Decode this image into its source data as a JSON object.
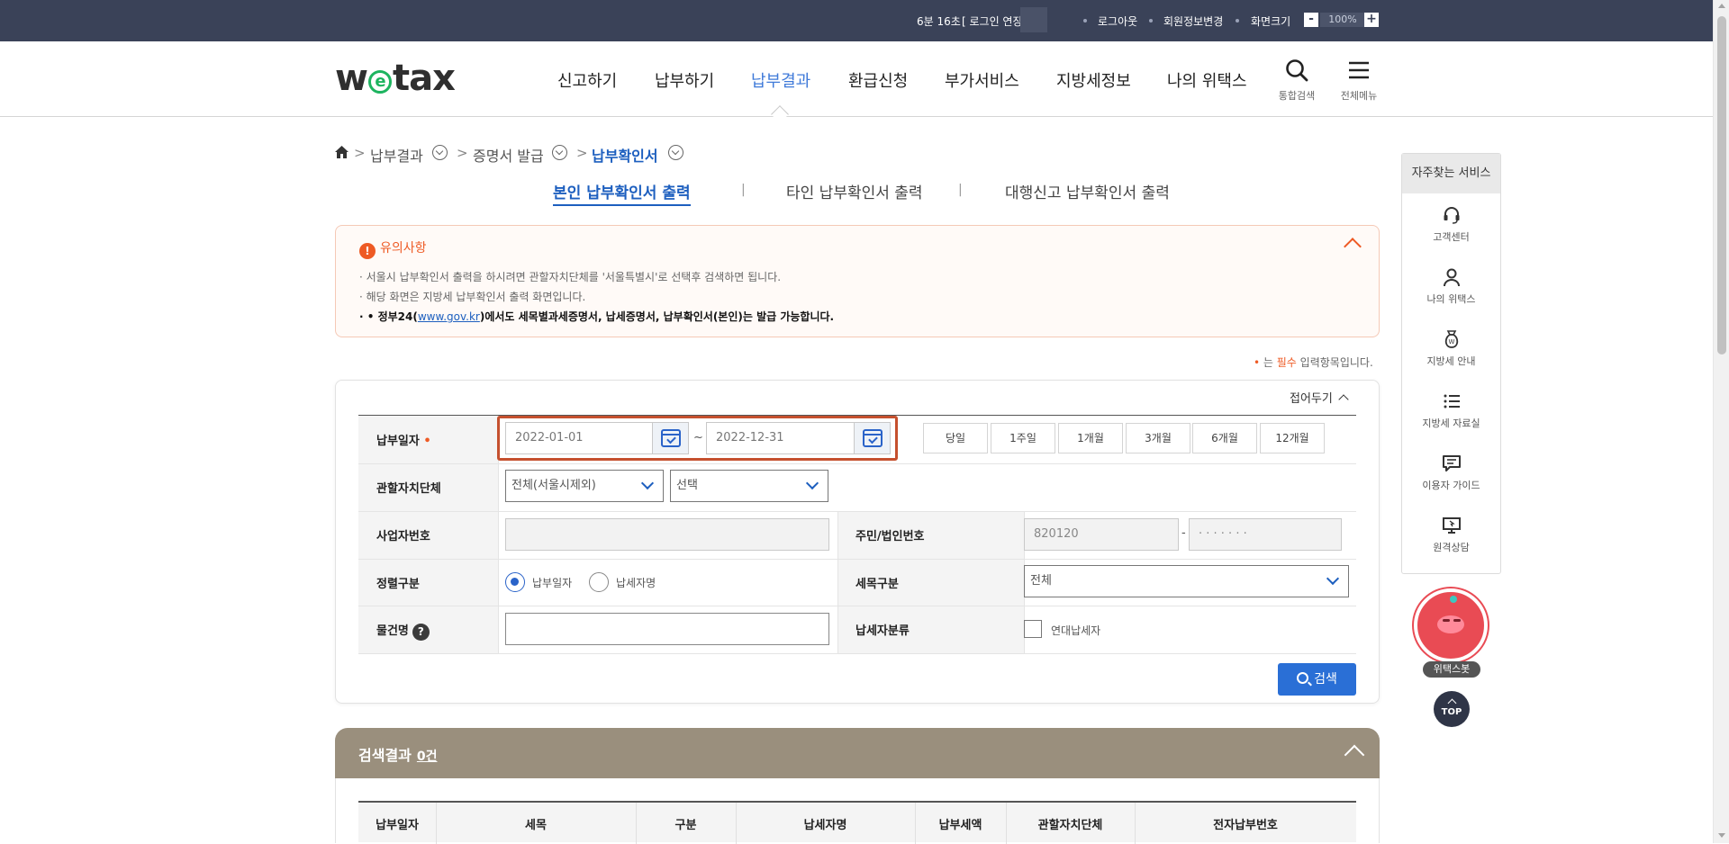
{
  "topbar": {
    "timer_text": "6분 16초",
    "login_extend": "[ 로그인 연장",
    "logout": "로그아웃",
    "profile_edit": "회원정보변경",
    "screen_size_label": "화면크기",
    "zoom_minus": "-",
    "zoom_value": "100%",
    "zoom_plus": "+"
  },
  "header": {
    "logo_pre": "w",
    "logo_e": "e",
    "logo_post": "tax",
    "nav": [
      "신고하기",
      "납부하기",
      "납부결과",
      "환급신청",
      "부가서비스",
      "지방세정보",
      "나의 위택스"
    ],
    "active_nav_index": 2,
    "search_label": "통합검색",
    "menu_label": "전체메뉴"
  },
  "breadcrumb": [
    "납부결과",
    "증명서 발급",
    "납부확인서"
  ],
  "tabs": [
    "본인 납부확인서 출력",
    "타인 납부확인서 출력",
    "대행신고 납부확인서 출력"
  ],
  "notice": {
    "title": "유의사항",
    "lines": [
      "· 서울시 납부확인서 출력을 하시려면 관할자치단체를 '서울특별시'로 선택후 검색하면 됩니다.",
      "· 해당 화면은 지방세 납부확인서 출력 화면입니다."
    ],
    "bold_pre": "· • 정부24(",
    "bold_link": "www.gov.kr",
    "bold_post": ")에서도 세목별과세증명서, 납세증명서, 납부확인서(본인)는 발급 가능합니다."
  },
  "required_note": {
    "mark": "•",
    "pre": " 는 ",
    "word": "필수",
    "post": " 입력항목입니다."
  },
  "form": {
    "fold_label": "접어두기",
    "pay_date_label": "납부일자",
    "req_mark": "•",
    "date_from": "2022-01-01",
    "date_tilde": "~",
    "date_to": "2022-12-31",
    "quick_ranges": [
      "당일",
      "1주일",
      "1개월",
      "3개월",
      "6개월",
      "12개월"
    ],
    "jurisdiction_label": "관할자치단체",
    "jurisdiction_sel1": "전체(서울시제외)",
    "jurisdiction_sel2": "선택",
    "biz_no_label": "사업자번호",
    "biz_no_value": "",
    "resident_label": "주민/법인번호",
    "resident_front": "820120",
    "resident_dash": "-",
    "resident_back": "· · · · · · ·",
    "sort_label": "정렬구분",
    "sort_options": [
      "납부일자",
      "납세자명"
    ],
    "sort_selected": "납부일자",
    "tax_type_label": "세목구분",
    "tax_type_value": "전체",
    "item_name_label": "물건명",
    "help_mark": "?",
    "taxpayer_class_label": "납세자분류",
    "joint_taxpayer_label": "연대납세자",
    "search_button": "검색"
  },
  "results": {
    "title": "검색결과",
    "count": "0건",
    "columns": [
      "납부일자",
      "세목",
      "구분",
      "납세자명",
      "납부세액",
      "관할자치단체",
      "전자납부번호"
    ]
  },
  "quick_menu": {
    "title": "자주찾는 서비스",
    "items": [
      {
        "label": "고객센터",
        "icon": "headset-icon"
      },
      {
        "label": "나의 위택스",
        "icon": "user-icon"
      },
      {
        "label": "지방세 안내",
        "icon": "money-bag-icon"
      },
      {
        "label": "지방세 자료실",
        "icon": "list-icon"
      },
      {
        "label": "이용자 가이드",
        "icon": "chat-icon"
      },
      {
        "label": "원격상담",
        "icon": "monitor-icon"
      }
    ],
    "bot_label": "위택스봇",
    "top_label": "TOP"
  },
  "colors": {
    "topbar_bg": "#3a4258",
    "accent_blue": "#1d5fbf",
    "notice_orange": "#ee5a24",
    "highlight_red": "#c5502e",
    "results_header": "#9a8f7d"
  }
}
